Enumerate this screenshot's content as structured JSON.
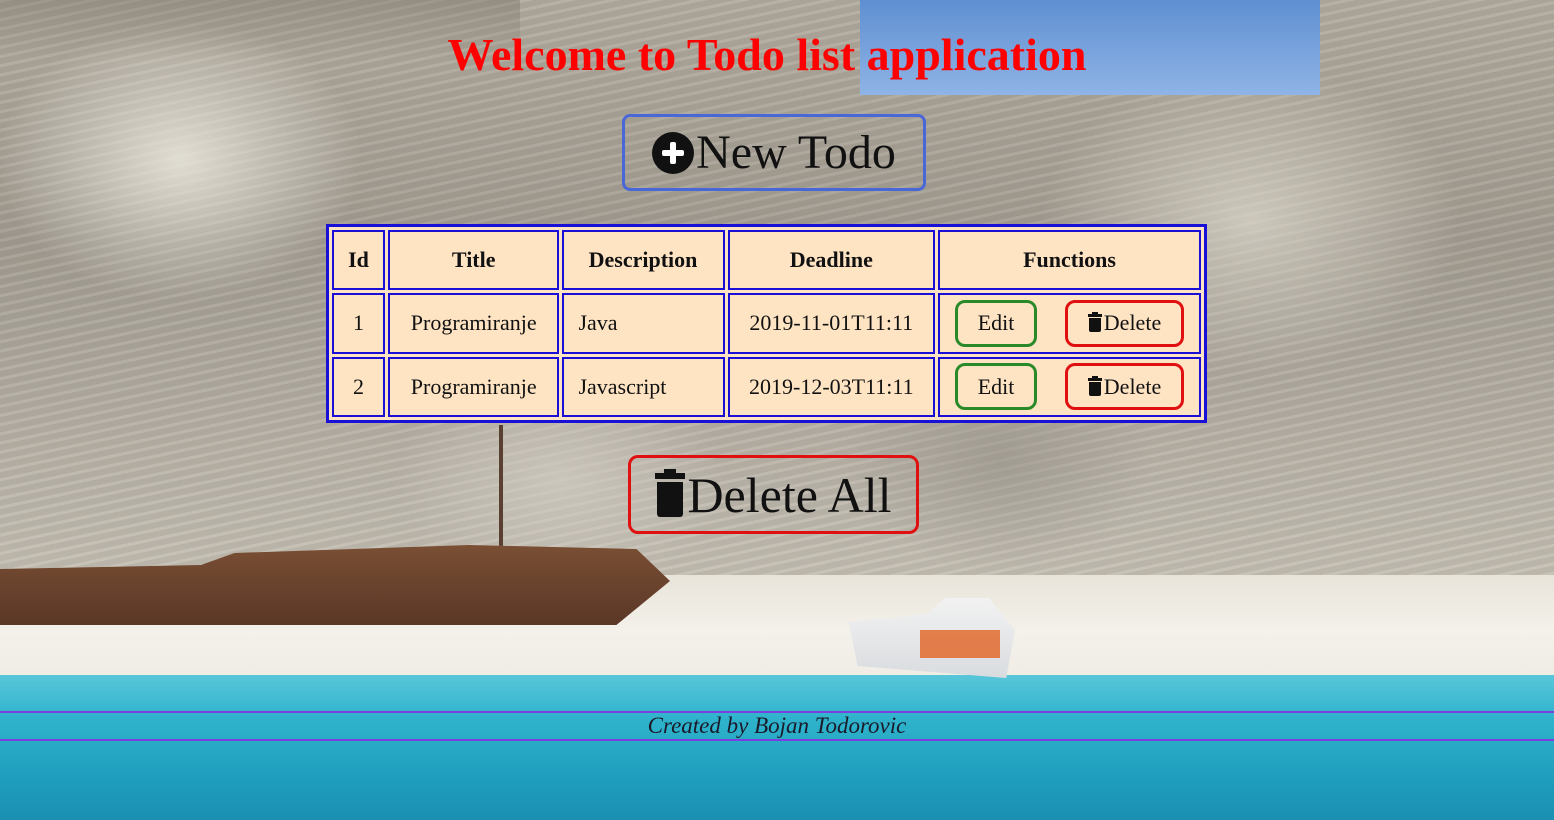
{
  "header": {
    "title": "Welcome to Todo list application"
  },
  "actions": {
    "new_todo_label": "New Todo",
    "delete_all_label": "Delete All"
  },
  "table": {
    "columns": [
      "Id",
      "Title",
      "Description",
      "Deadline",
      "Functions"
    ],
    "rows": [
      {
        "id": "1",
        "title": "Programiranje",
        "description": "Java",
        "deadline": "2019-11-01T11:11",
        "edit_label": "Edit",
        "delete_label": "Delete"
      },
      {
        "id": "2",
        "title": "Programiranje",
        "description": "Javascript",
        "deadline": "2019-12-03T11:11",
        "edit_label": "Edit",
        "delete_label": "Delete"
      }
    ]
  },
  "footer": {
    "text": "Created by Bojan Todorovic"
  },
  "icons": {
    "new_todo": "plus-circle-icon",
    "delete": "trash-icon"
  },
  "colors": {
    "title": "#ff0000",
    "new_todo_border": "#4a67d8",
    "table_border": "#1a0fd6",
    "table_background": "#ffe4c4",
    "edit_border": "#2a8a2a",
    "delete_border": "#e01010",
    "footer_lines": "#7b3fe0"
  }
}
